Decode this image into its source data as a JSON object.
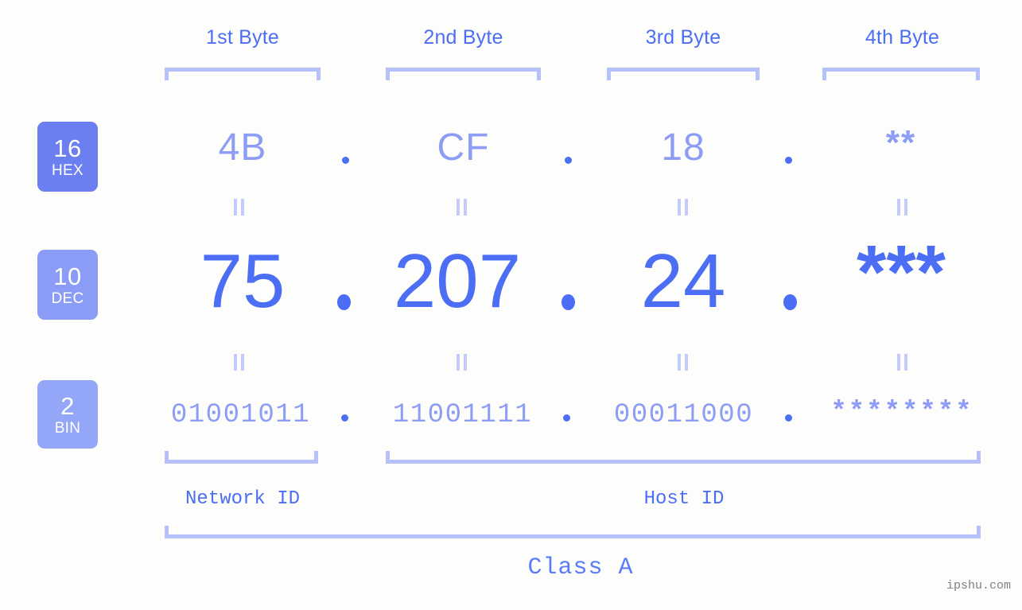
{
  "meta": {
    "background_color": "#fdfefb",
    "accent_color": "#4c6ef5",
    "light_accent_color": "#8d9cf4",
    "bracket_color": "#b6c0fb",
    "watermark": "ipshu.com"
  },
  "byte_headers": [
    {
      "label": "1st Byte"
    },
    {
      "label": "2nd Byte"
    },
    {
      "label": "3rd Byte"
    },
    {
      "label": "4th Byte"
    }
  ],
  "rows": [
    {
      "badge": {
        "base": "16",
        "name": "HEX",
        "color": "#6b7ff0"
      },
      "values": [
        "4B",
        "CF",
        "18",
        "**"
      ],
      "separator": "."
    },
    {
      "badge": {
        "base": "10",
        "name": "DEC",
        "color": "#8b9cf6"
      },
      "values": [
        "75",
        "207",
        "24",
        "***"
      ],
      "separator": "."
    },
    {
      "badge": {
        "base": "2",
        "name": "BIN",
        "color": "#93a6f8"
      },
      "values": [
        "01001011",
        "11001111",
        "00011000",
        "********"
      ],
      "separator": "."
    }
  ],
  "id_sections": [
    {
      "label": "Network ID"
    },
    {
      "label": "Host ID"
    }
  ],
  "class_section": {
    "label": "Class A"
  }
}
